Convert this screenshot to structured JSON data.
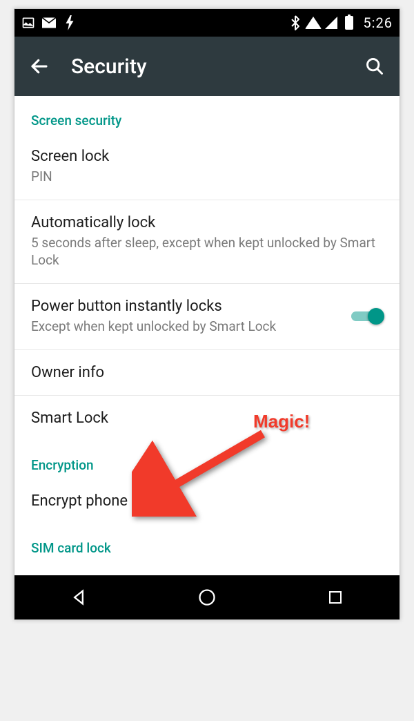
{
  "status": {
    "time": "5:26"
  },
  "appbar": {
    "title": "Security"
  },
  "sections": {
    "screen_security_header": "Screen security",
    "encryption_header": "Encryption",
    "sim_header": "SIM card lock"
  },
  "rows": {
    "screen_lock": {
      "title": "Screen lock",
      "sub": "PIN"
    },
    "auto_lock": {
      "title": "Automatically lock",
      "sub": "5 seconds after sleep, except when kept unlocked by Smart Lock"
    },
    "power_lock": {
      "title": "Power button instantly locks",
      "sub": "Except when kept unlocked by Smart Lock"
    },
    "owner_info": {
      "title": "Owner info"
    },
    "smart_lock": {
      "title": "Smart Lock"
    },
    "encrypt": {
      "title": "Encrypt phone"
    }
  },
  "toggles": {
    "power_lock_on": true
  },
  "annotation": {
    "label": "Magic!"
  },
  "colors": {
    "accent": "#009688",
    "appbar_bg": "#2e3a3f",
    "annotation": "#f13a2a"
  }
}
